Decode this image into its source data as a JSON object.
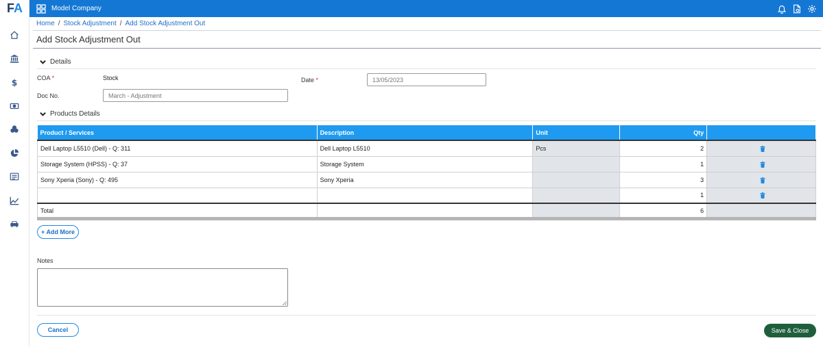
{
  "app": {
    "logo_f": "F",
    "logo_a": "A",
    "company": "Model Company"
  },
  "sidebar": {
    "icons": [
      "home-icon",
      "bank-icon",
      "dollar-icon",
      "cash-icon",
      "coins-icon",
      "pie-chart-icon",
      "list-icon",
      "trend-icon",
      "car-icon"
    ]
  },
  "topbar": {
    "icons": [
      "bell-icon",
      "document-settings-icon",
      "gear-icon"
    ]
  },
  "breadcrumb": {
    "items": [
      "Home",
      "Stock Adjustment",
      "Add Stock Adjustment Out"
    ],
    "separator": "/"
  },
  "page": {
    "title": "Add Stock Adjustment Out"
  },
  "details": {
    "header": "Details",
    "coa_label": "COA",
    "coa_value": "Stock",
    "date_label": "Date",
    "date_value": "13/05/2023",
    "doc_label": "Doc No.",
    "doc_placeholder": "March - Adjustment",
    "required_mark": "*"
  },
  "products": {
    "header": "Products Details",
    "columns": [
      "Product / Services",
      "Description",
      "Unit",
      "Qty"
    ],
    "rows": [
      {
        "product": "Dell Laptop L5510 (Dell) - Q: 311",
        "description": "Dell Laptop L5510",
        "unit": "Pcs",
        "qty": "2"
      },
      {
        "product": "Storage System (HPSS) - Q: 37",
        "description": "Storage System",
        "unit": "",
        "qty": "1"
      },
      {
        "product": "Sony Xperia (Sony) - Q: 495",
        "description": "Sony Xperia",
        "unit": "",
        "qty": "3"
      },
      {
        "product": "",
        "description": "",
        "unit": "",
        "qty": "1"
      }
    ],
    "total_label": "Total",
    "total_qty": "6",
    "add_more": "+ Add More"
  },
  "notes": {
    "label": "Notes",
    "value": ""
  },
  "footer": {
    "cancel": "Cancel",
    "save": "Save & Close"
  },
  "colors": {
    "topbar": "#1477d4",
    "table_header": "#1e9af0",
    "save_button": "#1f5e3c",
    "link": "#1e6fc7"
  }
}
